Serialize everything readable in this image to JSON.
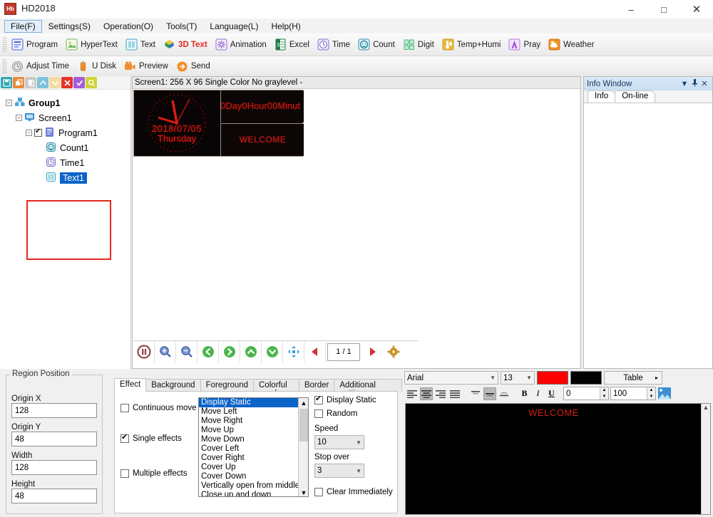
{
  "window": {
    "title": "HD2018",
    "app_icon": "app-icon",
    "minimize": "–",
    "maximize": "□",
    "close": "✕"
  },
  "menubar": {
    "items": [
      {
        "label": "File(F)",
        "active": true
      },
      {
        "label": "Settings(S)",
        "active": false
      },
      {
        "label": "Operation(O)",
        "active": false
      },
      {
        "label": "Tools(T)",
        "active": false
      },
      {
        "label": "Language(L)",
        "active": false
      },
      {
        "label": "Help(H)",
        "active": false
      }
    ]
  },
  "toolbar_main": {
    "items": [
      {
        "label": "Program",
        "icon": "program-icon",
        "color": "#4a63d8"
      },
      {
        "label": "HyperText",
        "icon": "hypertext-icon",
        "color": "#7bb661"
      },
      {
        "label": "Text",
        "icon": "text-icon",
        "color": "#3aa7c4"
      },
      {
        "label": "3D Text",
        "icon": "3d-text-icon",
        "color": "#2ca04f"
      },
      {
        "label": "Animation",
        "icon": "animation-icon",
        "color": "#9a6fd0"
      },
      {
        "label": "Excel",
        "icon": "excel-icon",
        "color": "#1e7a42"
      },
      {
        "label": "Time",
        "icon": "time-icon",
        "color": "#7e6fd0"
      },
      {
        "label": "Count",
        "icon": "count-icon",
        "color": "#2f8fa8"
      },
      {
        "label": "Digit",
        "icon": "digit-icon",
        "color": "#49b97a"
      },
      {
        "label": "Temp+Humi",
        "icon": "temp-humi-icon",
        "color": "#d2a23a"
      },
      {
        "label": "Pray",
        "icon": "pray-icon",
        "color": "#b977e0"
      },
      {
        "label": "Weather",
        "icon": "weather-icon",
        "color": "#ef8f2a"
      }
    ]
  },
  "toolbar_second": {
    "items": [
      {
        "label": "Adjust Time",
        "icon": "adjust-time-icon"
      },
      {
        "label": "U Disk",
        "icon": "u-disk-icon"
      },
      {
        "label": "Preview",
        "icon": "preview-icon"
      },
      {
        "label": "Send",
        "icon": "send-icon"
      }
    ]
  },
  "tree_toolbar": {
    "buttons": [
      {
        "name": "save-icon",
        "glyph": "⌸",
        "color": "#2fa7b5"
      },
      {
        "name": "duplicate-icon",
        "glyph": "❏",
        "color": "#e88a3c"
      },
      {
        "name": "copy-icon",
        "glyph": "❐",
        "color": "#bdbdbd"
      },
      {
        "name": "move-up-icon",
        "glyph": "⌃",
        "color": "#7fc2da"
      },
      {
        "name": "move-down-icon",
        "glyph": "⌄",
        "color": "#f0d79a"
      },
      {
        "name": "delete-icon",
        "glyph": "✕",
        "color": "#e5322a"
      },
      {
        "name": "confirm-icon",
        "glyph": "✔",
        "color": "#a35cd6"
      },
      {
        "name": "search-icon",
        "glyph": "🔍",
        "color": "#cdd438"
      }
    ]
  },
  "tree": {
    "nodes": [
      {
        "label": "Group1",
        "level": 0,
        "icon": "group-icon",
        "expander": "−",
        "bold": true,
        "checkbox": false,
        "selected": false
      },
      {
        "label": "Screen1",
        "level": 1,
        "icon": "screen-icon",
        "expander": "−",
        "bold": false,
        "checkbox": false,
        "selected": false
      },
      {
        "label": "Program1",
        "level": 2,
        "icon": "program-node-icon",
        "expander": "−",
        "bold": false,
        "checkbox": true,
        "checked": true,
        "selected": false
      },
      {
        "label": "Count1",
        "level": 3,
        "icon": "count-node-icon",
        "expander": "",
        "bold": false,
        "checkbox": false,
        "selected": false
      },
      {
        "label": "Time1",
        "level": 3,
        "icon": "time-node-icon",
        "expander": "",
        "bold": false,
        "checkbox": false,
        "selected": false
      },
      {
        "label": "Text1",
        "level": 3,
        "icon": "text-node-icon",
        "expander": "",
        "bold": false,
        "checkbox": false,
        "selected": true
      }
    ]
  },
  "canvas": {
    "screen_header": "Screen1: 256 X 96  Single Color No graylevel -",
    "led": {
      "clock_date": "2018/07/05",
      "clock_day": "Thursday",
      "countdown": "0Day0Hour00Minut",
      "welcome": "WELCOME",
      "led_color": "#e01a10"
    },
    "playbar": {
      "buttons": [
        {
          "name": "pause-button",
          "glyph": "❚❚",
          "color": "#8e4a4a"
        },
        {
          "name": "zoom-in-button",
          "glyph": "+",
          "color": "#5b7fc7"
        },
        {
          "name": "zoom-out-button",
          "glyph": "−",
          "color": "#5b7fc7"
        },
        {
          "name": "move-left-button",
          "glyph": "←",
          "color": "#4cb54c"
        },
        {
          "name": "move-right-button",
          "glyph": "→",
          "color": "#4cb54c"
        },
        {
          "name": "move-up-button",
          "glyph": "↑",
          "color": "#4cb54c"
        },
        {
          "name": "move-down-button",
          "glyph": "↓",
          "color": "#4cb54c"
        },
        {
          "name": "fit-button",
          "glyph": "✥",
          "color": "#3aa0d8"
        },
        {
          "name": "prev-page-button",
          "glyph": "◀",
          "color": "#d62f2f"
        }
      ],
      "page_indicator": "1 / 1",
      "next_button": {
        "name": "next-page-button",
        "glyph": "▶",
        "color": "#d62f2f"
      },
      "settings_button": {
        "name": "gear-icon",
        "glyph": "✸",
        "color": "#c8922a"
      }
    }
  },
  "info_window": {
    "title": "Info Window",
    "dropdown_icon": "▼",
    "pin_icon": "⇱",
    "close_icon": "✕",
    "tabs": [
      {
        "label": "Info",
        "active": true
      },
      {
        "label": "On-line",
        "active": false
      }
    ]
  },
  "region_position": {
    "group_title": "Region Position",
    "fields": [
      {
        "label": "Origin X",
        "value": "128"
      },
      {
        "label": "Origin Y",
        "value": "48"
      },
      {
        "label": "Width",
        "value": "128"
      },
      {
        "label": "Height",
        "value": "48"
      }
    ]
  },
  "effect_panel": {
    "tabs": [
      {
        "label": "Effect",
        "active": true
      },
      {
        "label": "Background",
        "active": false
      },
      {
        "label": "Foreground",
        "active": false
      },
      {
        "label": "Colorful word",
        "active": false
      },
      {
        "label": "Border",
        "active": false
      },
      {
        "label": "Additional settings->>",
        "active": false
      }
    ],
    "checkboxes_left": [
      {
        "label": "Continuous move",
        "checked": false
      },
      {
        "label": "Single effects",
        "checked": true
      },
      {
        "label": "Multiple effects",
        "checked": false
      }
    ],
    "effects_list": [
      {
        "label": "Display Static",
        "selected": true
      },
      {
        "label": "Move Left",
        "selected": false
      },
      {
        "label": "Move Right",
        "selected": false
      },
      {
        "label": "Move Up",
        "selected": false
      },
      {
        "label": "Move Down",
        "selected": false
      },
      {
        "label": "Cover Left",
        "selected": false
      },
      {
        "label": "Cover Right",
        "selected": false
      },
      {
        "label": "Cover Up",
        "selected": false
      },
      {
        "label": "Cover Down",
        "selected": false
      },
      {
        "label": "Vertically open from middle",
        "selected": false
      },
      {
        "label": "Close up and down",
        "selected": false
      }
    ],
    "right": {
      "display_static": {
        "label": "Display Static",
        "checked": true
      },
      "random": {
        "label": "Random",
        "checked": false
      },
      "speed_label": "Speed",
      "speed_value": "10",
      "stop_over_label": "Stop over",
      "stop_over_value": "3",
      "clear_immediately": {
        "label": "Clear Immediately",
        "checked": false
      }
    }
  },
  "text_editor": {
    "font_family": "Arial",
    "font_size": "13",
    "fore_color": "#ff0000",
    "back_color": "#000000",
    "table_label": "Table",
    "table_arrow": "▸",
    "align_buttons": [
      {
        "name": "align-left-button",
        "active": false
      },
      {
        "name": "align-center-button",
        "active": true
      },
      {
        "name": "align-right-button",
        "active": false
      },
      {
        "name": "align-justify-button",
        "active": false
      }
    ],
    "vertical_align_buttons": [
      {
        "name": "valign-top-button",
        "active": false
      },
      {
        "name": "valign-middle-button",
        "active": true
      },
      {
        "name": "valign-bottom-button",
        "active": false
      }
    ],
    "bold": "B",
    "italic": "I",
    "underline": "U",
    "spin1_value": "0",
    "spin2_value": "100",
    "image_button": "insert-image-icon",
    "content": "WELCOME"
  }
}
